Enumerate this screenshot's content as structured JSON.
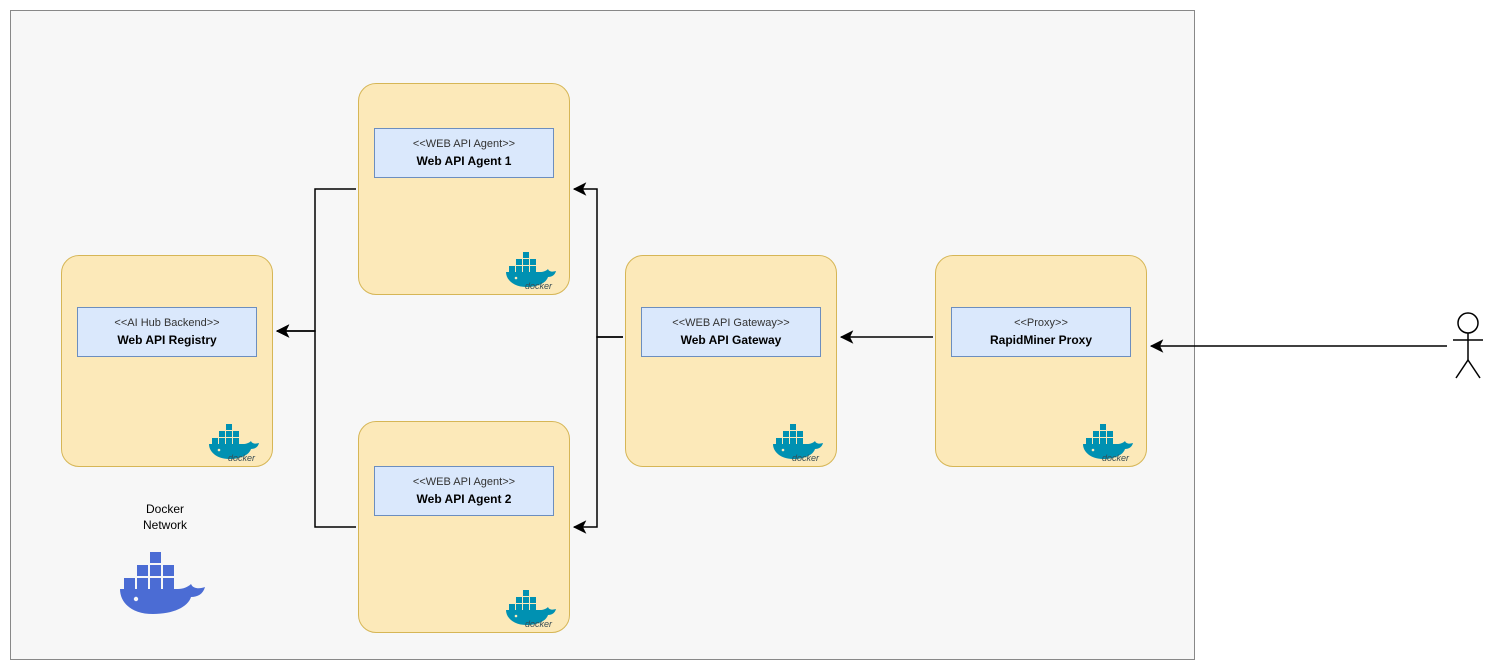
{
  "network": {
    "label_line1": "Docker",
    "label_line2": "Network"
  },
  "logos": {
    "small_label": "docker"
  },
  "containers": {
    "registry": {
      "stereo": "<<AI Hub Backend>>",
      "name": "Web API Registry"
    },
    "agent1": {
      "stereo": "<<WEB API Agent>>",
      "name": "Web API Agent 1"
    },
    "agent2": {
      "stereo": "<<WEB API Agent>>",
      "name": "Web API Agent 2"
    },
    "gateway": {
      "stereo": "<<WEB API Gateway>>",
      "name": "Web API Gateway"
    },
    "proxy": {
      "stereo": "<<Proxy>>",
      "name": "RapidMiner Proxy"
    }
  }
}
